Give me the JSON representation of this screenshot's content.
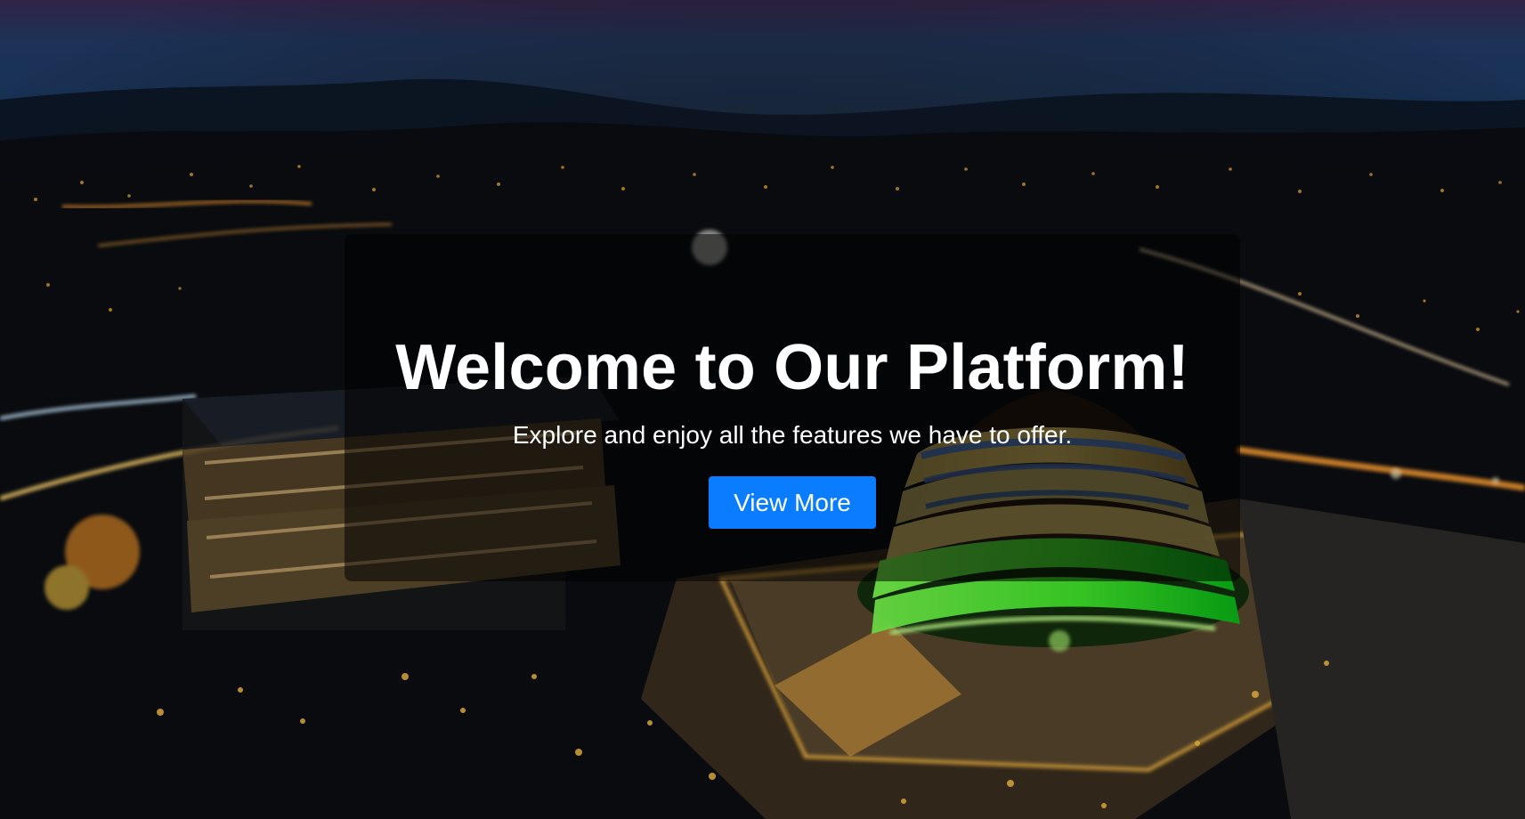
{
  "hero": {
    "title": "Welcome to Our Platform!",
    "subtitle": "Explore and enjoy all the features we have to offer.",
    "button_label": "View More"
  },
  "colors": {
    "panel_overlay": "rgba(0,0,0,0.53)",
    "button_blue": "#0a7cff",
    "text_white": "#ffffff",
    "dome_green": "#39ff2f",
    "city_light_gold": "#ffb52a",
    "sky_blue": "#21355f"
  },
  "background": {
    "icon": "night-cityscape-icon"
  }
}
